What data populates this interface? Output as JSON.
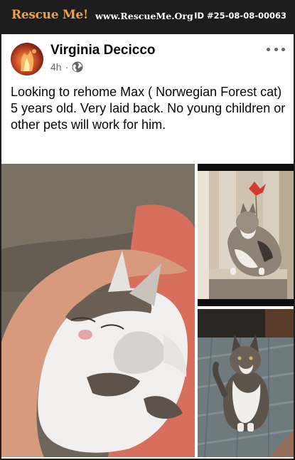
{
  "banner": {
    "brand": "Rescue Me!",
    "site": "www.RescueMe.Org",
    "pet_id": "ID #25-08-08-00063"
  },
  "post": {
    "author": "Virginia Decicco",
    "time": "4h",
    "separator": "·",
    "privacy_icon": "globe-icon",
    "menu_icon": "more-options-icon",
    "text": "Looking to rehome Max ( Norwegian Forest cat) 5 years old. Very laid back. No young children or other pets will work for him."
  },
  "photos": [
    {
      "subject": "cat sleeping on person's arm"
    },
    {
      "subject": "cat on cat tree with toy"
    },
    {
      "subject": "cat sitting on patterned rug"
    }
  ],
  "colors": {
    "banner_bg": "#1d1d1d",
    "brand": "#f2a23a",
    "author_text": "#050505",
    "meta_text": "#65676b"
  }
}
